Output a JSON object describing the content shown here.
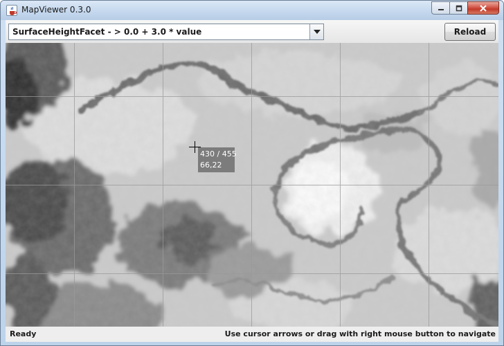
{
  "window": {
    "title": "MapViewer 0.3.0",
    "app_icon": "java-cup-icon",
    "controls": [
      "minimize-icon",
      "maximize-icon",
      "close-icon"
    ]
  },
  "toolbar": {
    "facet_selected": "SurfaceHeightFacet - > 0.0 + 3.0 * value",
    "reload_label": "Reload"
  },
  "map": {
    "tooltip_coords": "430 / 455",
    "tooltip_value": "66,22",
    "grid_color": "#9a9a9a"
  },
  "status": {
    "left": "Ready",
    "right": "Use cursor arrows or drag with right mouse button to navigate"
  },
  "colors": {
    "titlebar": "#c5d8ee",
    "close_button": "#c23a2a",
    "frame": "#bcd3ea"
  }
}
